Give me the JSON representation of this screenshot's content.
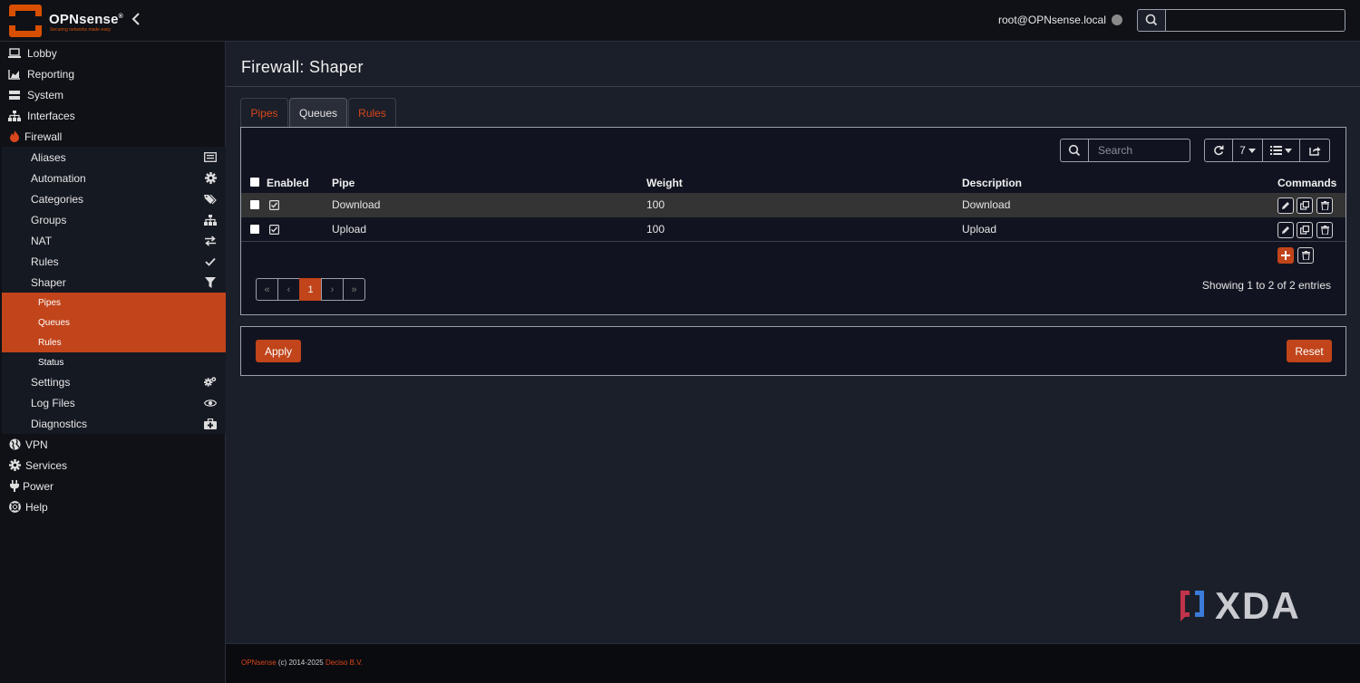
{
  "header": {
    "brand": "OPNsense",
    "brand_mark": "®",
    "tagline": "Securing networks made easy",
    "user": "root@OPNsense.local",
    "search_value": ""
  },
  "sidebar": {
    "items": [
      {
        "label": "Lobby",
        "icon": "laptop-icon"
      },
      {
        "label": "Reporting",
        "icon": "area-chart-icon"
      },
      {
        "label": "System",
        "icon": "server-icon"
      },
      {
        "label": "Interfaces",
        "icon": "sitemap-icon"
      },
      {
        "label": "Firewall",
        "icon": "fire-icon"
      }
    ],
    "firewall_items": [
      {
        "label": "Aliases",
        "icon": "list-alt-icon"
      },
      {
        "label": "Automation",
        "icon": "cog-icon"
      },
      {
        "label": "Categories",
        "icon": "tags-icon"
      },
      {
        "label": "Groups",
        "icon": "sitemap-icon"
      },
      {
        "label": "NAT",
        "icon": "exchange-icon"
      },
      {
        "label": "Rules",
        "icon": "check-icon"
      },
      {
        "label": "Shaper",
        "icon": "filter-icon"
      }
    ],
    "shaper_items": [
      {
        "label": "Pipes"
      },
      {
        "label": "Queues"
      },
      {
        "label": "Rules"
      },
      {
        "label": "Status"
      }
    ],
    "firewall_items_after": [
      {
        "label": "Settings",
        "icon": "cogs-icon"
      },
      {
        "label": "Log Files",
        "icon": "eye-icon"
      },
      {
        "label": "Diagnostics",
        "icon": "medkit-icon"
      }
    ],
    "items_after": [
      {
        "label": "VPN",
        "icon": "globe-icon"
      },
      {
        "label": "Services",
        "icon": "cog-icon"
      },
      {
        "label": "Power",
        "icon": "plug-icon"
      },
      {
        "label": "Help",
        "icon": "life-ring-icon"
      }
    ]
  },
  "page": {
    "title": "Firewall: Shaper",
    "tabs": [
      {
        "label": "Pipes"
      },
      {
        "label": "Queues",
        "active": true
      },
      {
        "label": "Rules"
      }
    ]
  },
  "grid": {
    "search_placeholder": "Search",
    "rows_per_page": "7",
    "columns": [
      "Enabled",
      "Pipe",
      "Weight",
      "Description",
      "Commands"
    ],
    "rows": [
      {
        "enabled": true,
        "pipe": "Download",
        "weight": "100",
        "description": "Download"
      },
      {
        "enabled": true,
        "pipe": "Upload",
        "weight": "100",
        "description": "Upload"
      }
    ],
    "pager": [
      "«",
      "‹",
      "1",
      "›",
      "»"
    ],
    "current_page": "1",
    "info": "Showing 1 to 2 of 2 entries"
  },
  "actions": {
    "apply": "Apply",
    "reset": "Reset"
  },
  "watermark": "XDA",
  "footer": {
    "brand": "OPNsense",
    "copyright": " (c) 2014-2025 ",
    "company": "Deciso B.V."
  },
  "colors": {
    "accent": "#c1441a",
    "background": "#1b1f29",
    "sidebar": "#0f1117"
  }
}
